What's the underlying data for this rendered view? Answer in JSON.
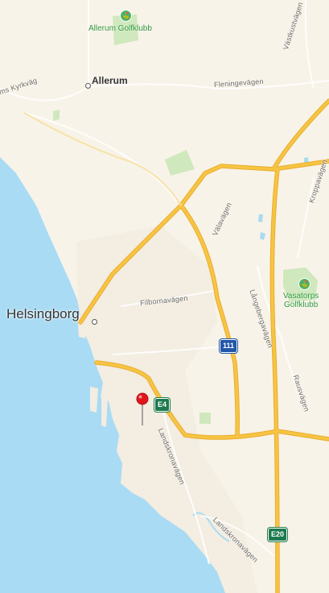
{
  "map": {
    "colors": {
      "land": "#f8f3e8",
      "water": "#a9dbf4",
      "highway": "#f7c443",
      "park": "#cfe8bd",
      "pin": "#e0161c"
    },
    "places": {
      "city": "Helsingborg",
      "allerum": "Allerum"
    },
    "pois": {
      "allerum_golf": "Allerum Golfklubb",
      "vasatorp_golf_line1": "Vasatorps",
      "vasatorp_golf_line2": "Golfklubb"
    },
    "roads": {
      "kyrkvag": "ms Kyrkväg",
      "fleningevagen": "Fleningevägen",
      "vastkustvagen": "Västkustvägen",
      "kroppavagen": "Kroppavägen",
      "valavagen": "Välavägen",
      "filbornavagen": "Filbornavägen",
      "langebergavagen": "Långebergavägen",
      "rausvagen": "Rausvägen",
      "landskronavagen_1": "Landskronavägen",
      "landskronavagen_2": "Landskronavägen"
    },
    "shields": {
      "e4": "E4",
      "r111": "111",
      "e20": "E20"
    },
    "icons": {
      "pin": "map-pin-icon",
      "golf": "golf-icon",
      "town_marker": "town-dot-icon"
    }
  }
}
